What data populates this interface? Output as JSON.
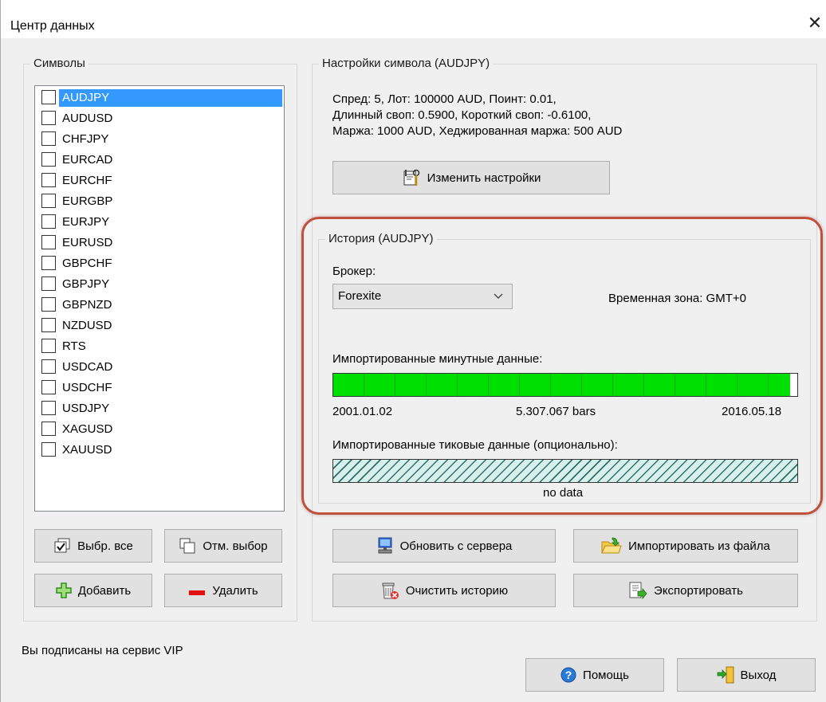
{
  "window": {
    "title": "Центр данных",
    "close_glyph": "✕"
  },
  "symbols": {
    "legend": "Символы",
    "items": [
      {
        "label": "AUDJPY",
        "checked": false,
        "selected": true
      },
      {
        "label": "AUDUSD",
        "checked": false,
        "selected": false
      },
      {
        "label": "CHFJPY",
        "checked": false,
        "selected": false
      },
      {
        "label": "EURCAD",
        "checked": false,
        "selected": false
      },
      {
        "label": "EURCHF",
        "checked": false,
        "selected": false
      },
      {
        "label": "EURGBP",
        "checked": false,
        "selected": false
      },
      {
        "label": "EURJPY",
        "checked": false,
        "selected": false
      },
      {
        "label": "EURUSD",
        "checked": false,
        "selected": false
      },
      {
        "label": "GBPCHF",
        "checked": false,
        "selected": false
      },
      {
        "label": "GBPJPY",
        "checked": false,
        "selected": false
      },
      {
        "label": "GBPNZD",
        "checked": false,
        "selected": false
      },
      {
        "label": "NZDUSD",
        "checked": false,
        "selected": false
      },
      {
        "label": "RTS",
        "checked": false,
        "selected": false
      },
      {
        "label": "USDCAD",
        "checked": false,
        "selected": false
      },
      {
        "label": "USDCHF",
        "checked": false,
        "selected": false
      },
      {
        "label": "USDJPY",
        "checked": false,
        "selected": false
      },
      {
        "label": "XAGUSD",
        "checked": false,
        "selected": false
      },
      {
        "label": "XAUUSD",
        "checked": false,
        "selected": false
      }
    ],
    "select_all_label": "Выбр. все",
    "deselect_label": "Отм. выбор",
    "add_label": "Добавить",
    "delete_label": "Удалить"
  },
  "settings": {
    "legend": "Настройки символа (AUDJPY)",
    "line1": "Спред: 5, Лот: 100000 AUD, Поинт: 0.01,",
    "line2": "Длинный своп: 0.5900, Короткий своп: -0.6100,",
    "line3": "Маржа: 1000 AUD, Хеджированная маржа: 500 AUD",
    "change_label": "Изменить настройки"
  },
  "history": {
    "legend": "История (AUDJPY)",
    "broker_label": "Брокер:",
    "broker_value": "Forexite",
    "timezone": "Временная зона: GMT+0",
    "minute_label": "Импортированные минутные данные:",
    "minute_fill": 0.985,
    "minute_start": "2001.01.02",
    "minute_bars": "5.307.067 bars",
    "minute_end": "2016.05.18",
    "tick_label": "Импортированные тиковые данные (опционально):",
    "tick_status": "no data"
  },
  "actions": {
    "update_label": "Обновить с сервера",
    "import_label": "Импортировать из файла",
    "clear_label": "Очистить историю",
    "export_label": "Экспортировать"
  },
  "footer": {
    "status": "Вы подписаны на сервис VIP",
    "help_label": "Помощь",
    "exit_label": "Выход"
  },
  "colors": {
    "selection": "#3399ff",
    "progress_green": "#00e000",
    "highlight_ring": "#c0503e"
  }
}
